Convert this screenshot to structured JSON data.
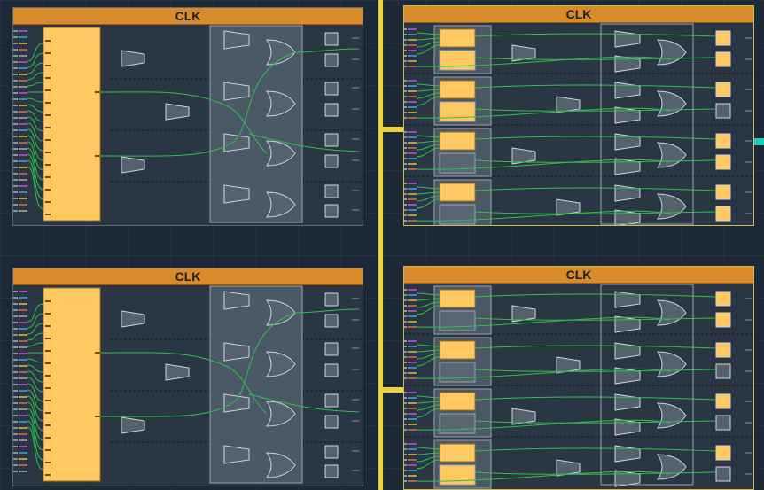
{
  "panels": [
    {
      "id": "top-left",
      "title": "CLK",
      "type": "sdram"
    },
    {
      "id": "top-right",
      "title": "CLK",
      "type": "flipflop"
    },
    {
      "id": "bottom-left",
      "title": "CLK",
      "type": "sdram"
    },
    {
      "id": "bottom-right",
      "title": "CLK",
      "type": "flipflop"
    }
  ],
  "colors": {
    "clock_header": "#d98a2b",
    "bus": "#f0d23a",
    "wire": "#2fbf4a",
    "block_fill": "#ffc861",
    "gate_fill": "#56616e",
    "background": "#1d2937",
    "marker": "#25c5c0"
  }
}
